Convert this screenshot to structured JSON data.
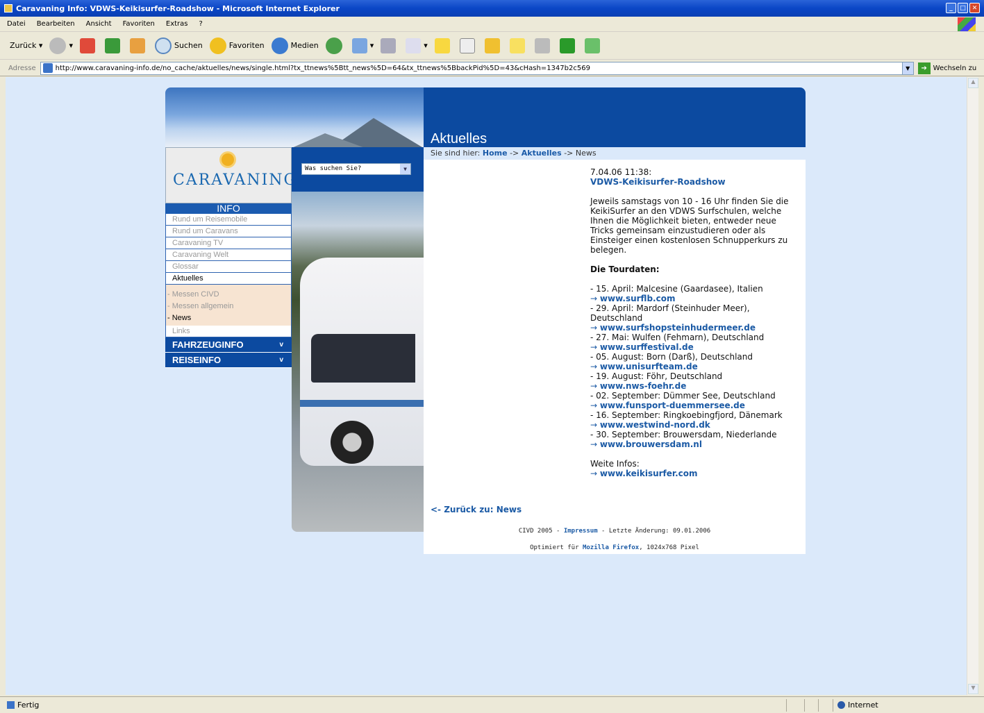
{
  "window": {
    "title": "Caravaning Info: VDWS-Keikisurfer-Roadshow - Microsoft Internet Explorer"
  },
  "menu": [
    "Datei",
    "Bearbeiten",
    "Ansicht",
    "Favoriten",
    "Extras",
    "?"
  ],
  "toolbar": {
    "back": "Zurück",
    "search": "Suchen",
    "favorites": "Favoriten",
    "media": "Medien"
  },
  "address": {
    "label": "Adresse",
    "url": "http://www.caravaning-info.de/no_cache/aktuelles/news/single.html?tx_ttnews%5Btt_news%5D=64&tx_ttnews%5BbackPid%5D=43&cHash=1347b2c569",
    "go": "Wechseln zu"
  },
  "status": {
    "text": "Fertig",
    "zone": "Internet"
  },
  "header": {
    "title": "Aktuelles"
  },
  "logo": {
    "word_a": "CARAVAN",
    "word_b": "ING",
    "sub": "INFO"
  },
  "nav": {
    "main": [
      "Rund um Reisemobile",
      "Rund um Caravans",
      "Caravaning TV",
      "Caravaning Welt",
      "Glossar",
      "Aktuelles"
    ],
    "sub": [
      "- Messen CIVD",
      "- Messen allgemein",
      "- News"
    ],
    "links": "Links",
    "fahrzeug": "FAHRZEUGINFO",
    "reise": "REISEINFO",
    "chev": "v"
  },
  "search": {
    "placeholder": "Was suchen Sie?"
  },
  "breadcrumb": {
    "prefix": "Sie sind hier:",
    "home": "Home",
    "sep1": "->",
    "section": "Aktuelles",
    "sep2": "->",
    "current": "News"
  },
  "article": {
    "date": "7.04.06 11:38:",
    "title": "VDWS-Keikisurfer-Roadshow",
    "intro": "Jeweils samstags von 10 - 16 Uhr finden Sie die KeikiSurfer an den VDWS Surfschulen, welche Ihnen die Möglichkeit bieten, entweder neue Tricks gemeinsam einzustudieren oder als Einsteiger einen kostenlosen Schnupperkurs zu belegen.",
    "tour_heading": "Die Tourdaten:",
    "tour": [
      {
        "text": "- 15. April: Malcesine (Gaardasee), Italien",
        "link": "www.surflb.com"
      },
      {
        "text": "- 29. April: Mardorf (Steinhuder Meer), Deutschland",
        "link": "www.surfshopsteinhudermeer.de"
      },
      {
        "text": "- 27. Mai: Wulfen (Fehmarn), Deutschland",
        "link": "www.surffestival.de"
      },
      {
        "text": "- 05. August: Born (Darß), Deutschland",
        "link": "www.unisurfteam.de"
      },
      {
        "text": "- 19. August: Föhr, Deutschland",
        "link": "www.nws-foehr.de"
      },
      {
        "text": "- 02. September: Dümmer See, Deutschland",
        "link": "www.funsport-duemmersee.de"
      },
      {
        "text": "- 16. September: Ringkoebingfjord, Dänemark",
        "link": "www.westwind-nord.dk"
      },
      {
        "text": "- 30. September: Brouwersdam, Niederlande",
        "link": "www.brouwersdam.nl"
      }
    ],
    "more_label": "Weite Infos:",
    "more_link": "www.keikisurfer.com",
    "arrow": "→"
  },
  "back_link": "<- Zurück zu: News",
  "footer": {
    "l1a": "CIVD 2005 - ",
    "impressum": "Impressum",
    "l1b": " - Letzte Änderung: 09.01.2006",
    "l2a": "Optimiert für ",
    "firefox": "Mozilla Firefox",
    "l2b": ", 1024x768 Pixel"
  }
}
